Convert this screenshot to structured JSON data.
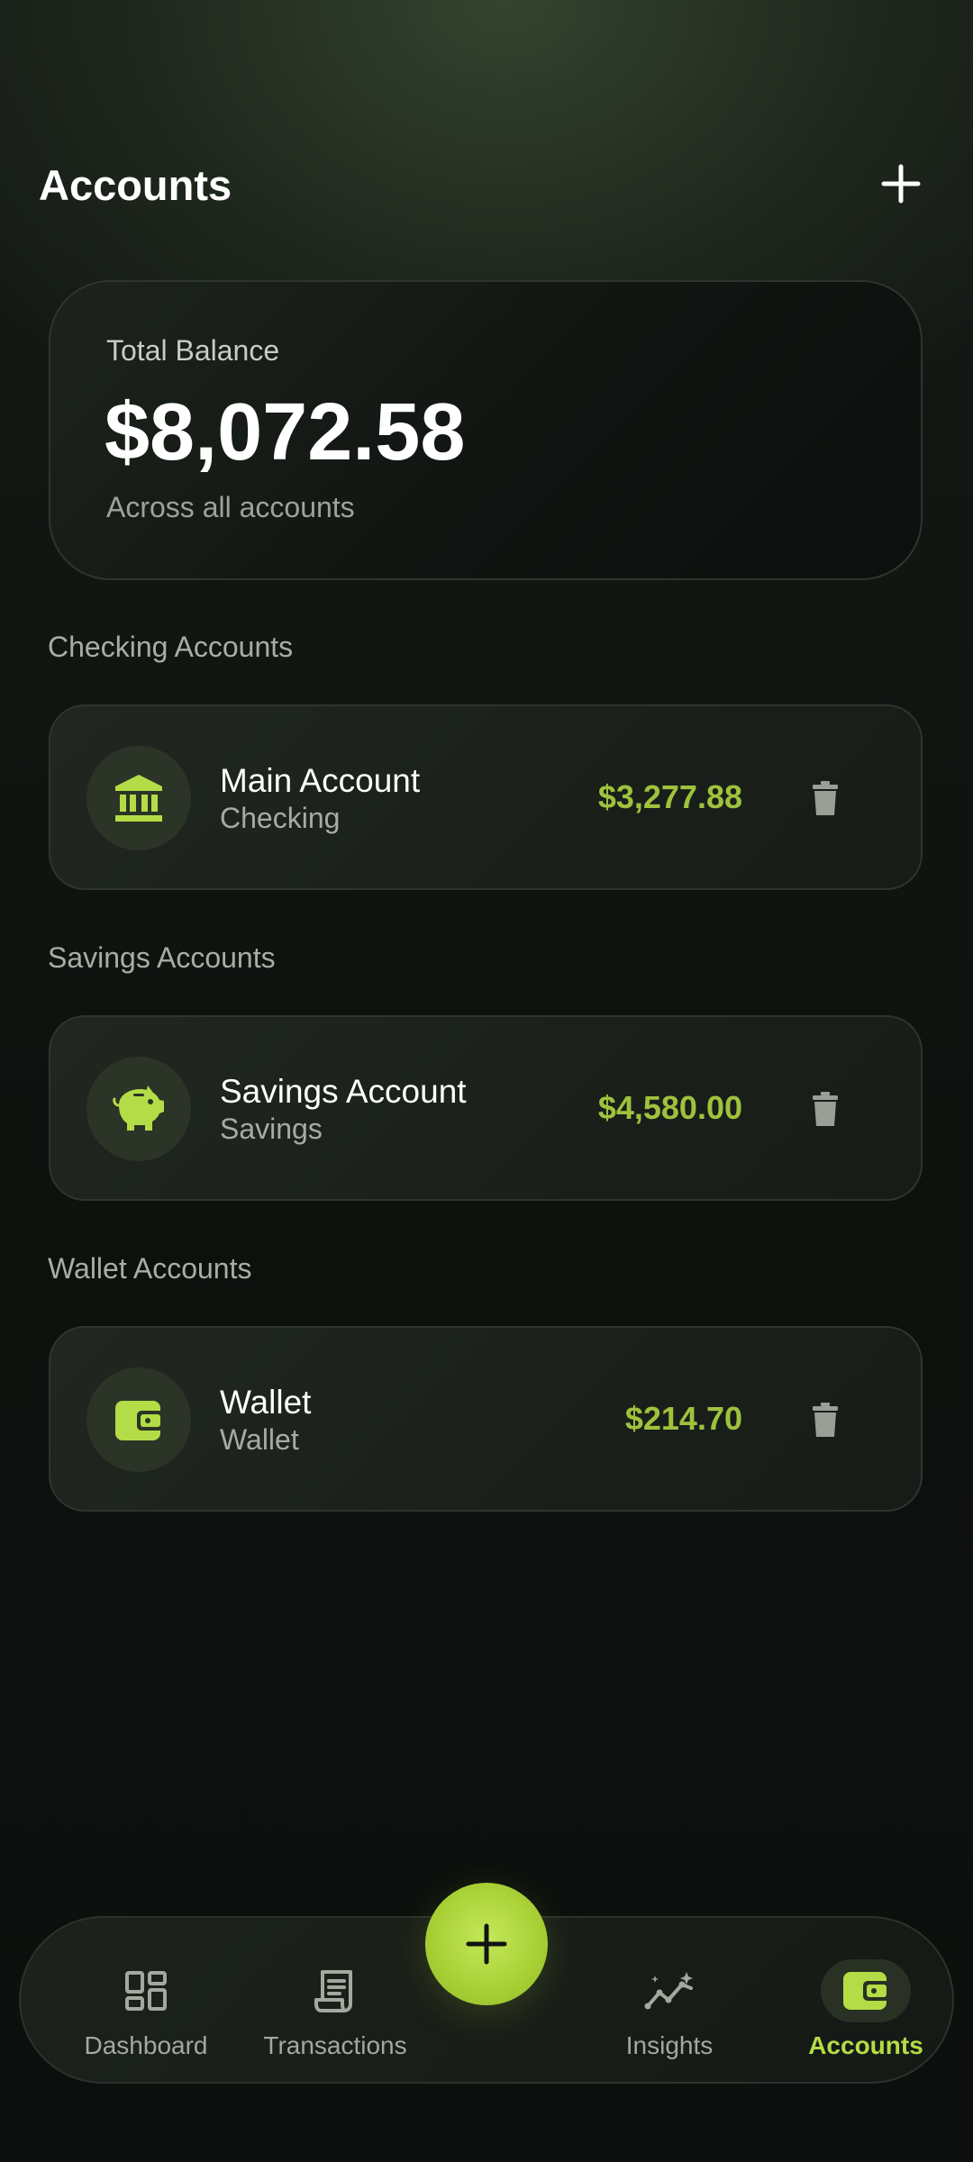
{
  "header": {
    "title": "Accounts",
    "add_icon": "plus-icon"
  },
  "balance": {
    "label": "Total Balance",
    "amount": "$8,072.58",
    "subtitle": "Across all accounts"
  },
  "sections": [
    {
      "title": "Checking Accounts",
      "account": {
        "name": "Main Account",
        "type": "Checking",
        "amount": "$3,277.88",
        "icon": "bank-icon"
      }
    },
    {
      "title": "Savings Accounts",
      "account": {
        "name": "Savings Account",
        "type": "Savings",
        "amount": "$4,580.00",
        "icon": "piggy-bank-icon"
      }
    },
    {
      "title": "Wallet Accounts",
      "account": {
        "name": "Wallet",
        "type": "Wallet",
        "amount": "$214.70",
        "icon": "wallet-icon"
      }
    }
  ],
  "nav": {
    "items": [
      {
        "label": "Dashboard",
        "icon": "dashboard-icon",
        "active": false
      },
      {
        "label": "Transactions",
        "icon": "receipt-icon",
        "active": false
      },
      {
        "label": "Insights",
        "icon": "insights-icon",
        "active": false
      },
      {
        "label": "Accounts",
        "icon": "wallet-icon",
        "active": true
      }
    ],
    "fab_icon": "plus-icon"
  },
  "colors": {
    "accent": "#A4CC3A",
    "amount": "#9FC23D",
    "card_bg": "#1B201B",
    "background": "#0E120F"
  }
}
